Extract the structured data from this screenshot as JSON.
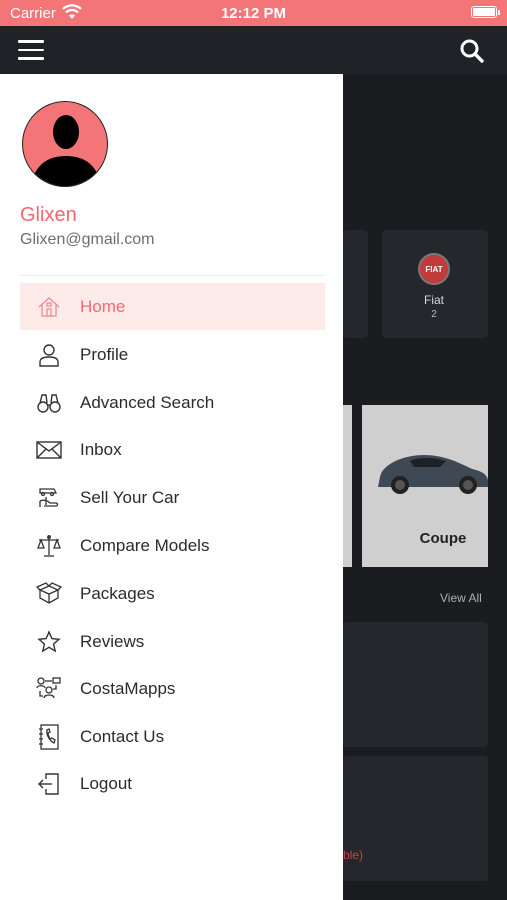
{
  "status_bar": {
    "carrier": "Carrier",
    "time": "12:12 PM"
  },
  "user": {
    "name": "Glixen",
    "email": "Glixen@gmail.com"
  },
  "menu": {
    "items": [
      {
        "label": "Home",
        "icon": "home-icon",
        "active": true
      },
      {
        "label": "Profile",
        "icon": "person-icon"
      },
      {
        "label": "Advanced Search",
        "icon": "binoculars-icon"
      },
      {
        "label": "Inbox",
        "icon": "envelope-icon"
      },
      {
        "label": "Sell Your Car",
        "icon": "hand-car-icon"
      },
      {
        "label": "Compare Models",
        "icon": "scales-icon"
      },
      {
        "label": "Packages",
        "icon": "box-icon"
      },
      {
        "label": "Reviews",
        "icon": "star-icon"
      },
      {
        "label": "CostaMapps",
        "icon": "network-icon"
      },
      {
        "label": "Contact Us",
        "icon": "address-book-icon"
      },
      {
        "label": "Logout",
        "icon": "logout-icon"
      }
    ]
  },
  "background": {
    "brand": {
      "logo_text": "FIAT",
      "name": "Fiat",
      "count": "2"
    },
    "car_card_label": "Coupe",
    "view_all": "View All",
    "partial_text": "ble)"
  },
  "colors": {
    "accent": "#f47577",
    "active_bg": "#fdebea",
    "drawer_bg": "#ffffff",
    "dark_bg": "#1b1d20"
  }
}
